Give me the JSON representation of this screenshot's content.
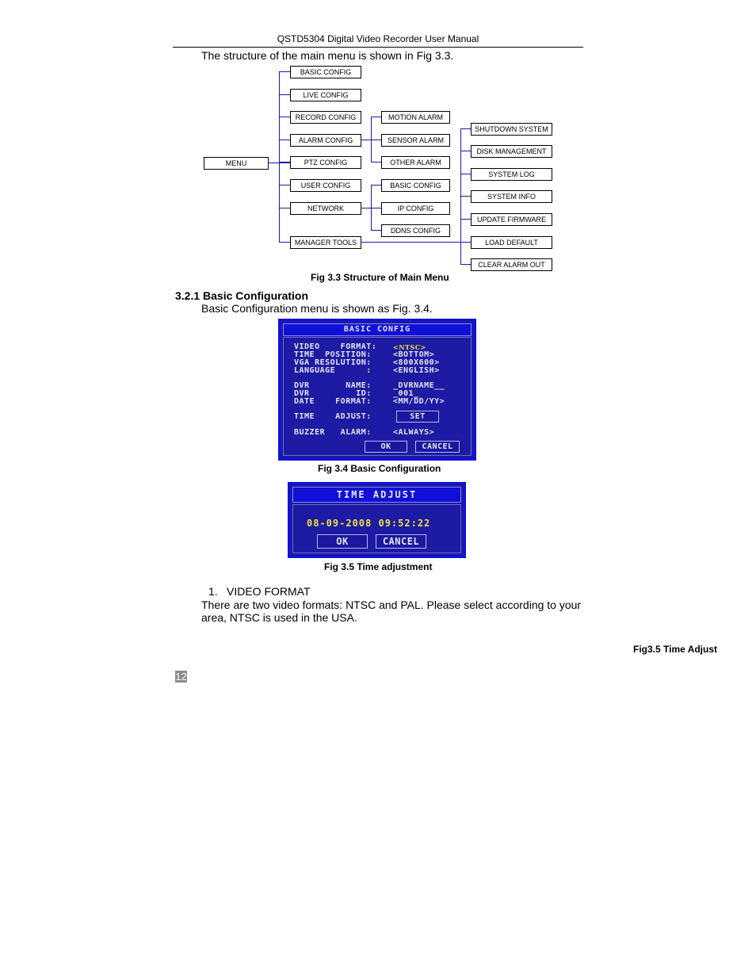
{
  "header": {
    "title": "QSTD5304 Digital Video Recorder User Manual"
  },
  "intro_text": "The structure of the main menu is shown in Fig 3.3.",
  "diagram": {
    "root": "MENU",
    "level1": [
      "BASIC CONFIG",
      "LIVE CONFIG",
      "RECORD CONFIG",
      "ALARM CONFIG",
      "PTZ CONFIG",
      "USER CONFIG",
      "NETWORK",
      "MANAGER TOOLS"
    ],
    "alarm_children": [
      "MOTION ALARM",
      "SENSOR ALARM",
      "OTHER ALARM"
    ],
    "network_children": [
      "BASIC CONFIG",
      "IP CONFIG",
      "DDNS CONFIG"
    ],
    "manager_children": [
      "SHUTDOWN SYSTEM",
      "DISK MANAGEMENT",
      "SYSTEM LOG",
      "SYSTEM INFO",
      "UPDATE FIRMWARE",
      "LOAD DEFAULT",
      "CLEAR ALARM OUT"
    ],
    "caption": "Fig 3.3 Structure of Main Menu",
    "line_color": "#1a1aa8"
  },
  "section": {
    "heading": "3.2.1  Basic Configuration",
    "text": "Basic Configuration menu is shown as Fig. 3.4."
  },
  "basic_config_screen": {
    "title": "BASIC CONFIG",
    "rows": [
      {
        "label": "VIDEO    FORMAT:",
        "value": "<NTSC>"
      },
      {
        "label": "TIME  POSITION:",
        "value": "<BOTTOM>"
      },
      {
        "label": "VGA RESOLUTION:",
        "value": "<800X600>"
      },
      {
        "label": "LANGUAGE      :",
        "value": "<ENGLISH>"
      },
      {
        "label": "DVR       NAME:",
        "value": "_DVRNAME__"
      },
      {
        "label": "DVR         ID:",
        "value": "_001_"
      },
      {
        "label": "DATE    FORMAT:",
        "value": "<MM/DD/YY>"
      },
      {
        "label": "TIME    ADJUST:",
        "value": "SET"
      },
      {
        "label": "BUZZER   ALARM:",
        "value": "<ALWAYS>"
      }
    ],
    "ok_label": "OK",
    "cancel_label": "CANCEL",
    "caption": "Fig 3.4 Basic Configuration",
    "bg_color": "#1d1aa3",
    "highlight_color": "#f0e040"
  },
  "time_adjust_screen": {
    "title": "TIME  ADJUST",
    "datetime": "08-09-2008 09:52:22",
    "ok_label": "OK",
    "cancel_label": "CANCEL",
    "caption": "Fig 3.5 Time adjustment"
  },
  "list_item": {
    "number": "1.",
    "title": "VIDEO FORMAT"
  },
  "body_lines": [
    "There are two video formats: NTSC and PAL. Please select according to your",
    "area, NTSC is used in the USA."
  ],
  "stray_caption": "Fig3.5 Time Adjust",
  "page_number": "12"
}
